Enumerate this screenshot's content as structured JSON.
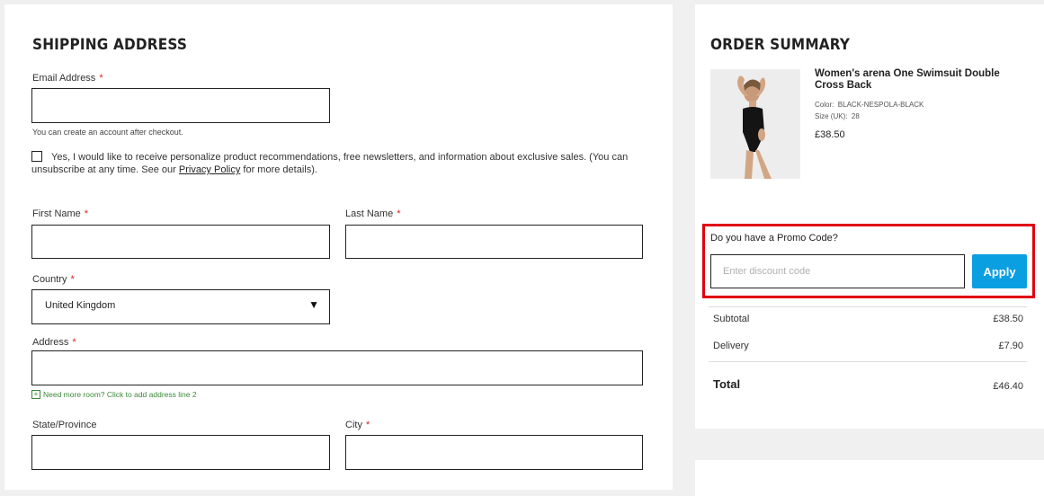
{
  "shipping": {
    "title": "SHIPPING ADDRESS",
    "email_label": "Email Address",
    "email_hint": "You can create an account after checkout.",
    "consent_text": "Yes, I would like to receive personalize product recommendations, free newsletters, and information about exclusive sales. (You can unsubscribe at any time. See our ",
    "privacy_link": "Privacy Policy",
    "consent_tail": " for more details).",
    "first_name_label": "First Name",
    "last_name_label": "Last Name",
    "country_label": "Country",
    "country_value": "United Kingdom",
    "address_label": "Address",
    "address_line2_hint": "Need more room? Click to add address line 2",
    "state_label": "State/Province",
    "city_label": "City",
    "required_mark": "*"
  },
  "summary": {
    "title": "ORDER SUMMARY",
    "product": {
      "name": "Women's arena One Swimsuit Double Cross Back",
      "color_label": "Color:",
      "color_value": "BLACK-NESPOLA-BLACK",
      "size_label": "Size (UK):",
      "size_value": "28",
      "price": "£38.50"
    },
    "promo_question": "Do you have a Promo Code?",
    "promo_placeholder": "Enter discount code",
    "apply_label": "Apply",
    "subtotal_label": "Subtotal",
    "subtotal_value": "£38.50",
    "delivery_label": "Delivery",
    "delivery_value": "£7.90",
    "total_label": "Total",
    "total_value": "£46.40"
  },
  "colors": {
    "accent_blue": "#0a9fe0",
    "highlight_red": "#e0000f",
    "required_red": "#e0201c"
  },
  "icons": {
    "dropdown": "triangle-down-icon",
    "plus": "plus-box-icon"
  }
}
